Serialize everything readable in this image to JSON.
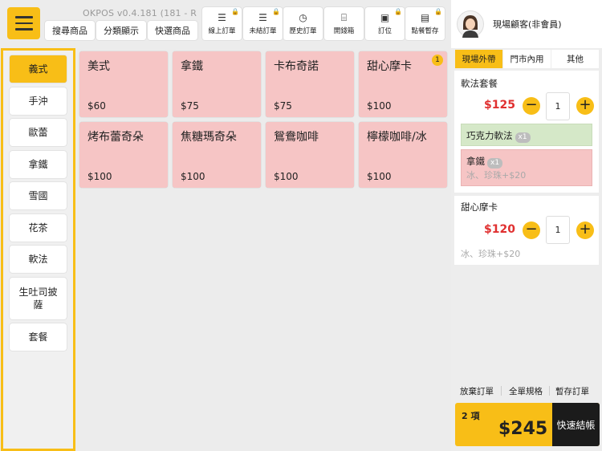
{
  "header": {
    "version": "OKPOS v0.4.181 (181 - R",
    "tabs": [
      "搜尋商品",
      "分類顯示",
      "快選商品"
    ],
    "tools": [
      {
        "label": "線上訂單",
        "icon": "list-icon",
        "glyph": "☰",
        "locked": true
      },
      {
        "label": "未結訂單",
        "icon": "list-icon",
        "glyph": "☰",
        "locked": true
      },
      {
        "label": "歷史訂單",
        "icon": "history-icon",
        "glyph": "◷",
        "locked": false
      },
      {
        "label": "開錢箱",
        "icon": "cash-drawer-icon",
        "glyph": "⌸",
        "locked": false
      },
      {
        "label": "訂位",
        "icon": "reservation-icon",
        "glyph": "▣",
        "locked": true
      },
      {
        "label": "點餐暫存",
        "icon": "archive-icon",
        "glyph": "▤",
        "locked": true
      }
    ]
  },
  "categories": [
    "義式",
    "手沖",
    "歐蕾",
    "拿鐵",
    "雪國",
    "花茶",
    "軟法",
    "生吐司披薩",
    "套餐"
  ],
  "active_category": 0,
  "products": [
    {
      "name": "美式",
      "price": "$60",
      "badge": ""
    },
    {
      "name": "拿鐵",
      "price": "$75",
      "badge": ""
    },
    {
      "name": "卡布奇諾",
      "price": "$75",
      "badge": ""
    },
    {
      "name": "甜心摩卡",
      "price": "$100",
      "badge": "1"
    },
    {
      "name": "烤布蕾奇朵",
      "price": "$100",
      "badge": ""
    },
    {
      "name": "焦糖瑪奇朵",
      "price": "$100",
      "badge": ""
    },
    {
      "name": "鴛鴦咖啡",
      "price": "$100",
      "badge": ""
    },
    {
      "name": "檸檬咖啡/冰",
      "price": "$100",
      "badge": ""
    }
  ],
  "customer": {
    "name": "現場顧客(非會員)"
  },
  "dining_tabs": [
    "現場外帶",
    "門市內用",
    "其他"
  ],
  "order": {
    "items": [
      {
        "name": "軟法套餐",
        "price": "$125",
        "qty": "1",
        "sub_items": [
          {
            "name": "巧克力軟法",
            "count": "x1",
            "note": "",
            "color": "#d5e8c8"
          },
          {
            "name": "拿鐵",
            "count": "x1",
            "note": "冰、珍珠+$20",
            "color": "#f6c5c5"
          }
        ]
      },
      {
        "name": "甜心摩卡",
        "price": "$120",
        "qty": "1",
        "note": "冰、珍珠+$20"
      }
    ]
  },
  "actions": [
    "放棄訂單",
    "全單規格",
    "暫存訂單"
  ],
  "summary": {
    "count": "2 項",
    "total": "$245",
    "checkout": "快速結帳"
  },
  "colors": {
    "accent": "#f8be17",
    "product_card": "#f6c5c5",
    "price_red": "#e03030",
    "combo_green": "#d5e8c8"
  }
}
